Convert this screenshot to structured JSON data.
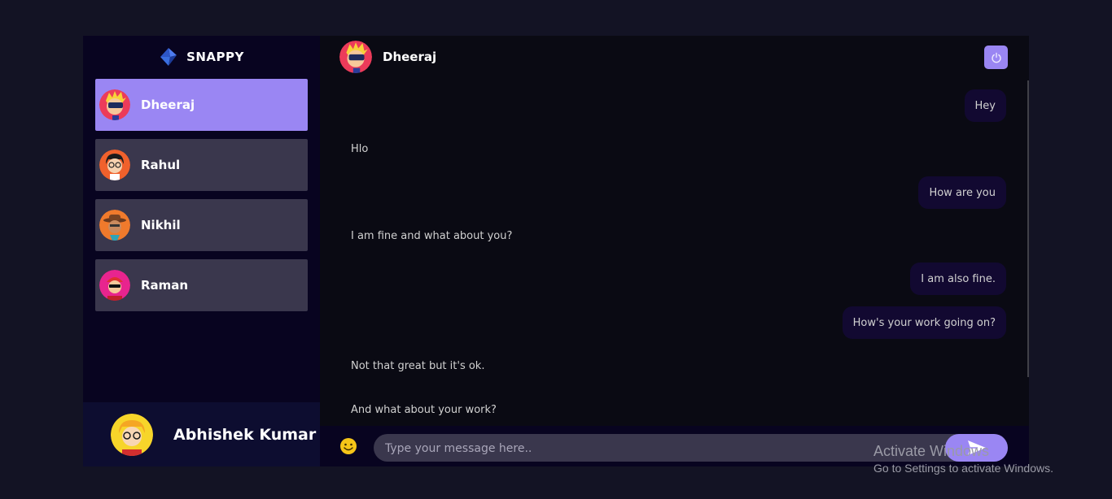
{
  "brand": {
    "name": "SNAPPY",
    "logo_icon": "snappy-logo-icon"
  },
  "contacts": [
    {
      "name": "Dheeraj",
      "selected": true
    },
    {
      "name": "Rahul",
      "selected": false
    },
    {
      "name": "Nikhil",
      "selected": false
    },
    {
      "name": "Raman",
      "selected": false
    }
  ],
  "current_user": {
    "name": "Abhishek Kumar"
  },
  "chat": {
    "header_name": "Dheeraj",
    "logout_icon": "power-icon",
    "messages": [
      {
        "text": "Hey",
        "direction": "sent"
      },
      {
        "text": "Hlo",
        "direction": "received"
      },
      {
        "text": "How are you",
        "direction": "sent"
      },
      {
        "text": "I am fine and what about you?",
        "direction": "received"
      },
      {
        "text": "I am also fine.",
        "direction": "sent"
      },
      {
        "text": "How's your work going on?",
        "direction": "sent"
      },
      {
        "text": "Not that great but it's ok.",
        "direction": "received"
      },
      {
        "text": "And what about your work?",
        "direction": "received"
      }
    ],
    "input": {
      "placeholder": "Type your message here..",
      "value": ""
    },
    "emoji_icon": "emoji-icon",
    "send_icon": "send-icon"
  },
  "watermark": {
    "title": "Activate Windows",
    "subtitle": "Go to Settings to activate Windows."
  },
  "colors": {
    "accent": "#9a86f3",
    "background": "#131324",
    "sidebar": "#080420",
    "sent_bubble": "#4f04ff21"
  }
}
